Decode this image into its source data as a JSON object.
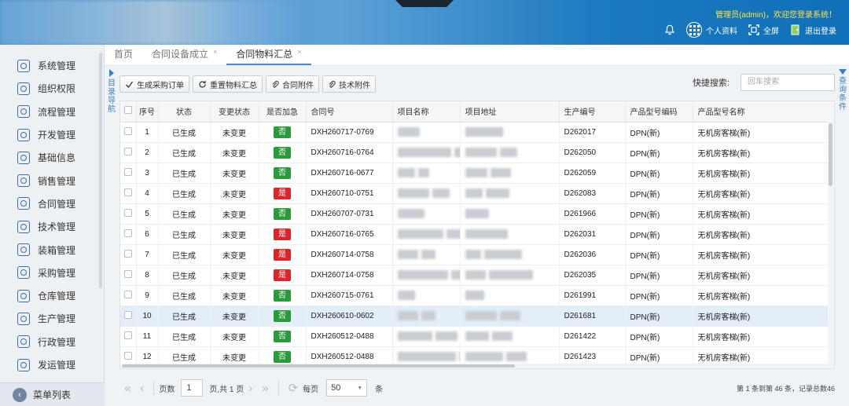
{
  "header": {
    "welcome": "管理员(admin)，欢迎您登录系统！",
    "profile": "个人资料",
    "fullscreen": "全屏",
    "logout": "退出登录"
  },
  "sidebar": {
    "items": [
      {
        "label": "系统管理"
      },
      {
        "label": "组织权限"
      },
      {
        "label": "流程管理"
      },
      {
        "label": "开发管理"
      },
      {
        "label": "基础信息"
      },
      {
        "label": "销售管理"
      },
      {
        "label": "合同管理"
      },
      {
        "label": "技术管理"
      },
      {
        "label": "装箱管理"
      },
      {
        "label": "采购管理"
      },
      {
        "label": "仓库管理"
      },
      {
        "label": "生产管理"
      },
      {
        "label": "行政管理"
      },
      {
        "label": "发运管理"
      }
    ],
    "footer": "菜单列表"
  },
  "tabs": [
    {
      "label": "首页",
      "closable": false
    },
    {
      "label": "合同设备成立",
      "closable": true
    },
    {
      "label": "合同物料汇总",
      "closable": true,
      "active": true
    }
  ],
  "side_labels": {
    "left": "目录导航",
    "right": "查询条件"
  },
  "toolbar": {
    "buttons": [
      "生成采购订单",
      "重置物料汇总",
      "合同附件",
      "技术附件"
    ],
    "quick_search_label": "快捷搜索:",
    "quick_search_placeholder": "回车搜索"
  },
  "grid": {
    "columns": [
      "序号",
      "状态",
      "变更状态",
      "是否加急",
      "合同号",
      "项目名称",
      "项目地址",
      "生产编号",
      "产品型号编码",
      "产品型号名称"
    ],
    "rows": [
      {
        "no": "1",
        "status": "已生成",
        "change": "未变更",
        "urgent": "否",
        "contract": "DXH260717-0769",
        "prod_no": "D262017",
        "model_code": "DPN(新)",
        "model_name": "无机房客梯(新)"
      },
      {
        "no": "2",
        "status": "已生成",
        "change": "未变更",
        "urgent": "否",
        "contract": "DXH260716-0764",
        "prod_no": "D262050",
        "model_code": "DPN(新)",
        "model_name": "无机房客梯(新)"
      },
      {
        "no": "3",
        "status": "已生成",
        "change": "未变更",
        "urgent": "否",
        "contract": "DXH260716-0677",
        "prod_no": "D262059",
        "model_code": "DPN(新)",
        "model_name": "无机房客梯(新)"
      },
      {
        "no": "4",
        "status": "已生成",
        "change": "未变更",
        "urgent": "是",
        "contract": "DXH260710-0751",
        "prod_no": "D262083",
        "model_code": "DPN(新)",
        "model_name": "无机房客梯(新)"
      },
      {
        "no": "5",
        "status": "已生成",
        "change": "未变更",
        "urgent": "否",
        "contract": "DXH260707-0731",
        "prod_no": "D261966",
        "model_code": "DPN(新)",
        "model_name": "无机房客梯(新)"
      },
      {
        "no": "6",
        "status": "已生成",
        "change": "未变更",
        "urgent": "是",
        "contract": "DXH260716-0765",
        "prod_no": "D262031",
        "model_code": "DPN(新)",
        "model_name": "无机房客梯(新)"
      },
      {
        "no": "7",
        "status": "已生成",
        "change": "未变更",
        "urgent": "是",
        "contract": "DXH260714-0758",
        "prod_no": "D262036",
        "model_code": "DPN(新)",
        "model_name": "无机房客梯(新)"
      },
      {
        "no": "8",
        "status": "已生成",
        "change": "未变更",
        "urgent": "是",
        "contract": "DXH260714-0758",
        "prod_no": "D262035",
        "model_code": "DPN(新)",
        "model_name": "无机房客梯(新)"
      },
      {
        "no": "9",
        "status": "已生成",
        "change": "未变更",
        "urgent": "否",
        "contract": "DXH260715-0761",
        "prod_no": "D261991",
        "model_code": "DPN(新)",
        "model_name": "无机房客梯(新)"
      },
      {
        "no": "10",
        "status": "已生成",
        "change": "未变更",
        "urgent": "否",
        "contract": "DXH260610-0602",
        "prod_no": "D261681",
        "model_code": "DPN(新)",
        "model_name": "无机房客梯(新)",
        "highlighted": true
      },
      {
        "no": "11",
        "status": "已生成",
        "change": "未变更",
        "urgent": "否",
        "contract": "DXH260512-0488",
        "prod_no": "D261422",
        "model_code": "DPN(新)",
        "model_name": "无机房客梯(新)"
      },
      {
        "no": "12",
        "status": "已生成",
        "change": "未变更",
        "urgent": "否",
        "contract": "DXH260512-0488",
        "prod_no": "D261423",
        "model_code": "DPN(新)",
        "model_name": "无机房客梯(新)"
      }
    ]
  },
  "pager": {
    "page_label": "页数",
    "page_value": "1",
    "total_pages": "页,共 1 页",
    "per_page_label": "每页",
    "per_page_value": "50",
    "per_page_unit": "条",
    "info": "第 1 条到第 46 条，记录总数46"
  },
  "colors": {
    "accent": "#3e8ed8",
    "urgent_yes": "#d9262a",
    "urgent_no": "#2a9a3a",
    "welcome_text": "#ffe24a"
  }
}
